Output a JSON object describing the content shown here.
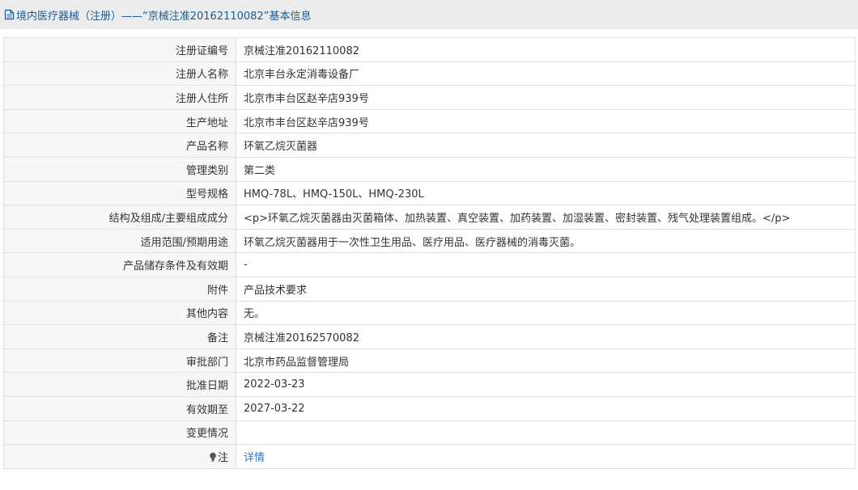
{
  "header": {
    "title": "境内医疗器械（注册）——“京械注准20162110082”基本信息"
  },
  "rows": [
    {
      "label": "注册证编号",
      "value": "京械注准20162110082"
    },
    {
      "label": "注册人名称",
      "value": "北京丰台永定消毒设备厂"
    },
    {
      "label": "注册人住所",
      "value": "北京市丰台区赵辛店939号"
    },
    {
      "label": "生产地址",
      "value": "北京市丰台区赵辛店939号"
    },
    {
      "label": "产品名称",
      "value": "环氧乙烷灭菌器"
    },
    {
      "label": "管理类别",
      "value": "第二类"
    },
    {
      "label": "型号规格",
      "value": "HMQ-78L、HMQ-150L、HMQ-230L"
    },
    {
      "label": "结构及组成/主要组成成分",
      "value": "<p>环氧乙烷灭菌器由灭菌箱体、加热装置、真空装置、加药装置、加湿装置、密封装置、残气处理装置组成。</p>"
    },
    {
      "label": "适用范围/预期用途",
      "value": "环氧乙烷灭菌器用于一次性卫生用品、医疗用品、医疗器械的消毒灭菌。"
    },
    {
      "label": "产品储存条件及有效期",
      "value": "-"
    },
    {
      "label": "附件",
      "value": "产品技术要求"
    },
    {
      "label": "其他内容",
      "value": "无。"
    },
    {
      "label": "备注",
      "value": "京械注准20162570082"
    },
    {
      "label": "审批部门",
      "value": "北京市药品监督管理局"
    },
    {
      "label": "批准日期",
      "value": "2022-03-23"
    },
    {
      "label": "有效期至",
      "value": "2027-03-22"
    },
    {
      "label": "变更情况",
      "value": ""
    }
  ],
  "note_row": {
    "label": "注",
    "link": "详情",
    "icon": "bulb-icon"
  },
  "colors": {
    "title_text": "#1b5a94",
    "title_bar_bg": "#ececec",
    "link": "#2a78c4",
    "label_cell_bg": "#f7f7f7",
    "border": "#e0e0e0"
  }
}
